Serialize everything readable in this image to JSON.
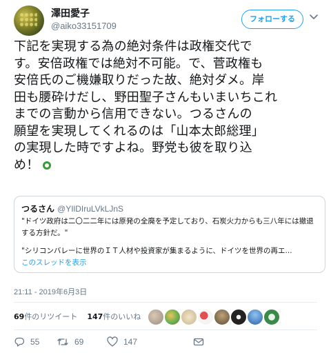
{
  "user": {
    "display_name": "澤田愛子",
    "handle": "@aiko33151709",
    "follow_label": "フォローする"
  },
  "tweet": {
    "lines": [
      "下記を実現する為の絶対条件は政権交代で",
      "す。安倍政権では絶対不可能。で、菅政権も",
      "安倍氏のご機嫌取りだった故、絶対ダメ。岸",
      "田も腰砕けだし、野田聖子さんもいまいちこれ",
      "までの言動から信用できない。つるさんの",
      "願望を実現してくれるのは「山本太郎総理」",
      "の実現した時ですよね。野党も彼を取り込",
      "め！"
    ],
    "emoji": "green-circle-emoji"
  },
  "quote": {
    "name": "つるさん",
    "handle": "@YIlDIruLVkLJnS",
    "text1": "\"ドイツ政府は二〇二二年には原発の全廃を予定しており、石炭火力からも三八年には撤退する方針だ。\"",
    "text2": "\"シリコンバレーに世界のＩＴ人材や投資家が集まるように、ドイツを世界の再エ...",
    "thread_link": "このスレッドを表示"
  },
  "timestamp": "21:11 - 2019年6月3日",
  "stats": {
    "retweet_count": "69",
    "retweet_label": "件のリツイート",
    "like_count": "147",
    "like_label": "件のいいね"
  },
  "actions": {
    "reply_count": "55",
    "retweet_count": "69",
    "like_count": "147"
  },
  "colors": {
    "accent": "#1da1f2",
    "secondary_text": "#657786",
    "divider": "#e6ecf0"
  }
}
